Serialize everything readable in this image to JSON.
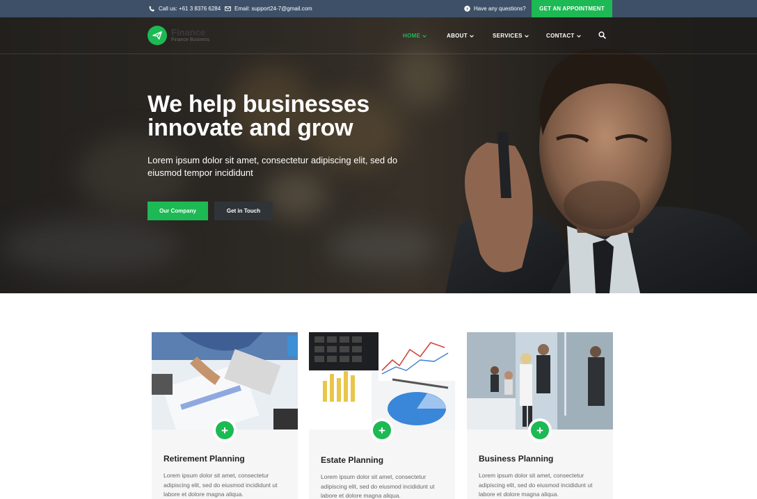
{
  "topbar": {
    "phone": "Call us: +61 3 8376 6284",
    "email": "Email: support24-7@gmail.com",
    "question": "Have any questions?",
    "appointment": "GET AN APPOINTMENT"
  },
  "brand": {
    "name": "Finance",
    "tagline": "Finance Business"
  },
  "nav": {
    "items": [
      {
        "label": "HOME",
        "active": true
      },
      {
        "label": "ABOUT",
        "active": false
      },
      {
        "label": "SERVICES",
        "active": false
      },
      {
        "label": "CONTACT",
        "active": false
      }
    ]
  },
  "hero": {
    "headline_line1": "We help businesses",
    "headline_line2": "innovate and grow",
    "subtext": "Lorem ipsum dolor sit amet, consectetur adipiscing elit, sed do eiusmod tempor incididunt",
    "primary_button": "Our Company",
    "secondary_button": "Get in Touch"
  },
  "cards": [
    {
      "title": "Retirement Planning",
      "desc": "Lorem ipsum dolor sit amet, consectetur adipiscing elit, sed do eiusmod incididunt ut labore et dolore magna aliqua."
    },
    {
      "title": "Estate Planning",
      "desc": "Lorem ipsum dolor sit amet, consectetur adipiscing elit, sed do eiusmod incididunt ut labore et dolore magna aliqua."
    },
    {
      "title": "Business Planning",
      "desc": "Lorem ipsum dolor sit amet, consectetur adipiscing elit, sed do eiusmod incididunt ut labore et dolore magna aliqua."
    }
  ],
  "colors": {
    "accent": "#1db954",
    "topbar": "#3d5068",
    "dark_button": "#2f3438"
  },
  "icons": {
    "phone": "phone-icon",
    "email": "envelope-icon",
    "question": "question-circle-icon",
    "logo": "paper-plane-icon",
    "search": "search-icon",
    "plus": "plus-icon"
  }
}
